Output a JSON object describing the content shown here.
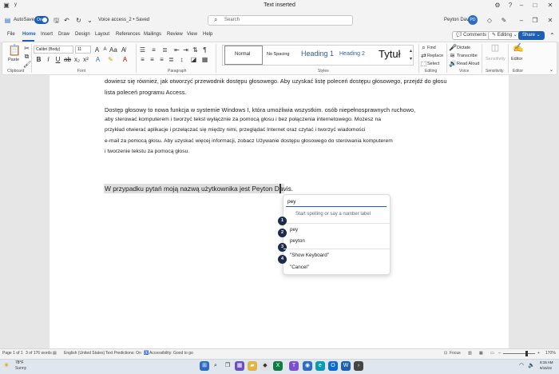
{
  "window": {
    "title": "Text inserted",
    "short_title": "y"
  },
  "titlebar": {
    "autosave_label": "AutoSave",
    "autosave_state": "On",
    "doc_name": "Voice access_2 • Saved",
    "search_placeholder": "Search",
    "user_name": "Peyton Davis",
    "user_initials": "PD"
  },
  "tabs": [
    "File",
    "Home",
    "Insert",
    "Draw",
    "Design",
    "Layout",
    "References",
    "Mailings",
    "Review",
    "View",
    "Help"
  ],
  "tab_actions": {
    "comments": "Comments",
    "editing": "Editing",
    "share": "Share"
  },
  "ribbon": {
    "paste_label": "Paste",
    "font_name": "Calibri (Body)",
    "font_size": "11",
    "styles": [
      "Normal",
      "No Spacing",
      "Heading 1",
      "Heading 2",
      "Tytuł"
    ],
    "editing": {
      "find": "Find",
      "replace": "Replace",
      "select": "Select"
    },
    "voice": {
      "dictate": "Dictate",
      "transcribe": "Transcribe",
      "read_aloud": "Read Aloud"
    },
    "sensitivity_label": "Sensitivity",
    "editor_label": "Editor",
    "groups": {
      "clipboard": "Clipboard",
      "font": "Font",
      "paragraph": "Paragraph",
      "styles": "Styles",
      "editing": "Editing",
      "voice": "Voice",
      "sensitivity": "Sensitivity",
      "editor": "Editor"
    }
  },
  "document": {
    "para1": [
      "dowiesz się również, jak otworzyć przewodnik dostępu głosowego. Aby uzyskać listę poleceń dostępu głosowego, przejdź do głosu",
      "lista poleceń programu Access."
    ],
    "para2": [
      "Dostęp głosowy to nowa funkcja w systemie Windows I, która umożliwia wszystkim. osób niepełnosprawnych ruchowo,",
      "aby sterować komputerem i tworzyć tekst wyłącznie za pomocą głosu i bez połączenia internetowego. Możesz na",
      "przykład otwierać aplikacje i przełączać się między nimi, przeglądać Internet oraz czytać i tworzyć wiadomości",
      "e-mail za pomocą głosu. Aby uzyskać więcej informacji, zobacz Używanie dostępu głosowego do sterowania komputerem",
      "i tworzenie tekstu za pomocą głosu."
    ],
    "target_sentence": "W przypadku pytań moją nazwą użytkownika jest Peyton Davis."
  },
  "voice_popup": {
    "input_value": "pey",
    "hint": "Start spelling or say a number label",
    "options": [
      {
        "num": "1",
        "text": ""
      },
      {
        "num": "2",
        "text": "pey"
      },
      {
        "num": "3",
        "text": "peyton"
      },
      {
        "num": "4",
        "text": "\"Show Keyboard\""
      },
      {
        "num": "",
        "text": "\"Cancel\""
      }
    ]
  },
  "statusbar": {
    "page": "Page 1 of 1",
    "words": "3 of 176 words",
    "language": "English (United States)",
    "predictions": "Text Predictions: On",
    "accessibility": "Accessibility: Good to go",
    "focus": "Focus",
    "zoom": "170%"
  },
  "taskbar": {
    "weather_temp": "78°F",
    "weather_desc": "Sunny",
    "time": "9:15 AM",
    "date": "9/15/22"
  }
}
